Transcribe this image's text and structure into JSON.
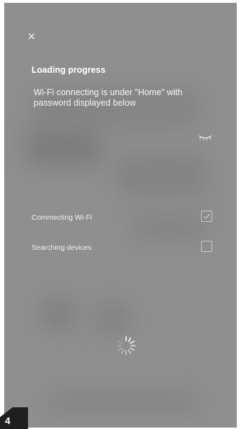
{
  "dialog": {
    "close_icon": "close-icon",
    "title": "Loading progress",
    "subtitle": "Wi-Fi connecting is under \"Home\" with password displayed below",
    "password_visibility_icon": "eye-closed-icon"
  },
  "steps": [
    {
      "label": "Commecting Wi-Fi",
      "checked": true
    },
    {
      "label": "Searching devices",
      "checked": false
    }
  ],
  "loading_icon": "spinner-icon",
  "page_marker": {
    "number": "4"
  },
  "colors": {
    "overlay": "#8f8f8f",
    "text": "#ffffff",
    "checkbox_border": "#c9c9c9"
  }
}
